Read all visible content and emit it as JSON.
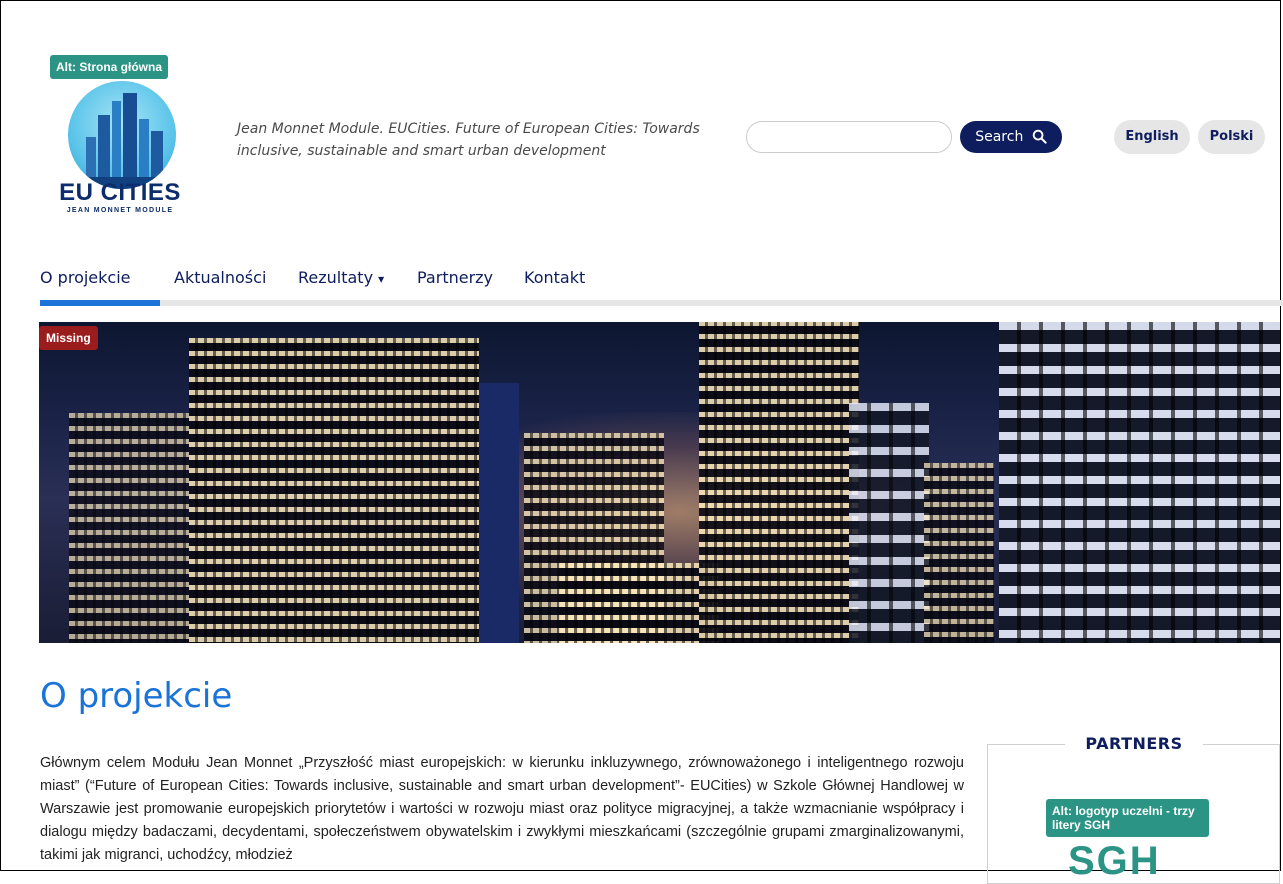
{
  "header": {
    "logo_alt": "Alt: Strona główna",
    "logo_title": "EU CITIES",
    "logo_subtitle": "JEAN MONNET MODULE",
    "tagline": "Jean Monnet Module. EUCities. Future of European Cities: Towards inclusive, sustainable and smart urban development",
    "search": {
      "placeholder": "",
      "button_label": "Search",
      "icon": "search-icon"
    },
    "languages": [
      "English",
      "Polski"
    ]
  },
  "nav": {
    "items": [
      {
        "label": "O projekcie",
        "active": true
      },
      {
        "label": "Aktualności"
      },
      {
        "label": "Rezultaty",
        "dropdown": true
      },
      {
        "label": "Partnerzy"
      },
      {
        "label": "Kontakt"
      }
    ],
    "dropdown_caret": "▾"
  },
  "hero": {
    "missing_badge": "Missing"
  },
  "main": {
    "title": "O projekcie",
    "body": "Głównym celem Modułu Jean Monnet „Przyszłość miast europejskich: w kierunku inkluzywnego, zrównoważonego i inteligentnego rozwoju miast” (“Future of European Cities: Towards inclusive, sustainable and smart urban development”- EUCities) w Szkole Głównej Handlowej w Warszawie jest promowanie europejskich priorytetów i wartości w rozwoju miast oraz polityce migracyjnej, a także wzmacnianie współpracy i dialogu między badaczami, decydentami, społeczeństwem obywatelskim i zwykłymi mieszkańcami (szczególnie grupami zmarginalizowanymi, takimi jak migranci, uchodźcy, młodzież"
  },
  "partners": {
    "title": "PARTNERS",
    "logo_alt": "Alt: logotyp uczelni - trzy litery SGH",
    "logo_text": "SGH"
  },
  "colors": {
    "navy": "#0d1d5e",
    "accent_blue": "#1a73d9",
    "alt_badge": "#2b9484",
    "missing_badge": "#9b1c1c"
  }
}
